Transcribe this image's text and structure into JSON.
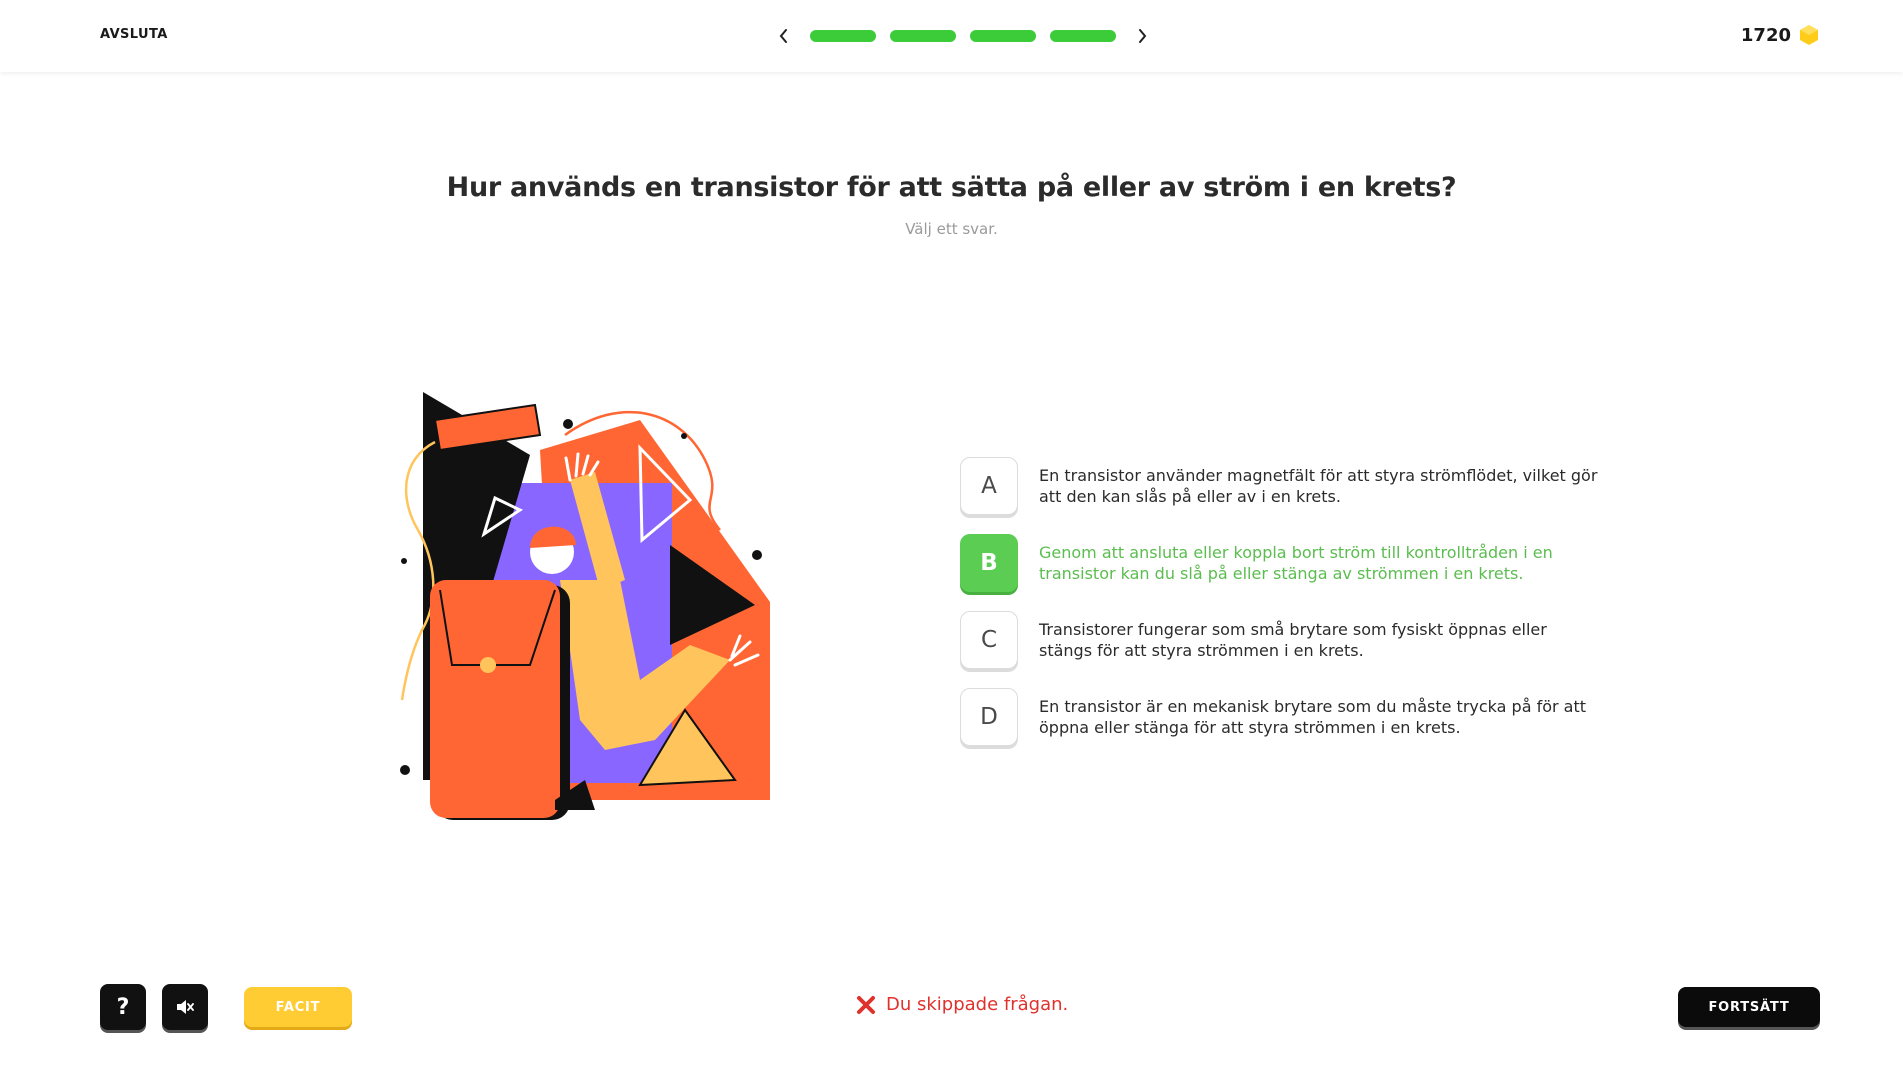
{
  "header": {
    "exit_label": "AVSLUTA",
    "progress": {
      "segments_total": 4,
      "segments_completed": 4,
      "color": "#3ccc3a"
    },
    "score": "1720",
    "coin_icon": "hexagon-coin-icon"
  },
  "question": {
    "title": "Hur används en transistor för att sätta på eller av ström i en krets?",
    "hint": "Välj ett svar."
  },
  "answers": [
    {
      "letter": "A",
      "text": "En transistor använder magnetfält för att styra strömflödet, vilket gör att den kan slås på eller av i en krets.",
      "state": "default"
    },
    {
      "letter": "B",
      "text": "Genom att ansluta eller koppla bort ström till kontrolltråden i en transistor kan du slå på eller stänga av strömmen i en krets.",
      "state": "correct"
    },
    {
      "letter": "C",
      "text": "Transistorer fungerar som små brytare som fysiskt öppnas eller stängs för att styra strömmen i en krets.",
      "state": "default"
    },
    {
      "letter": "D",
      "text": "En transistor är en mekanisk brytare som du måste trycka på för att öppna eller stänga för att styra strömmen i en krets.",
      "state": "default"
    }
  ],
  "footer": {
    "help_label": "?",
    "sound_icon": "speaker-mute-icon",
    "facit_label": "FACIT",
    "status_text": "Du skippade frågan.",
    "status_icon": "red-x-icon",
    "continue_label": "FORTSÄTT"
  },
  "colors": {
    "correct_green": "#5bcd52",
    "facit_yellow": "#ffcc33",
    "error_red": "#e0322c",
    "illustration_orange": "#ff6633",
    "illustration_purple": "#8866ff",
    "illustration_yellow": "#ffc55c"
  }
}
